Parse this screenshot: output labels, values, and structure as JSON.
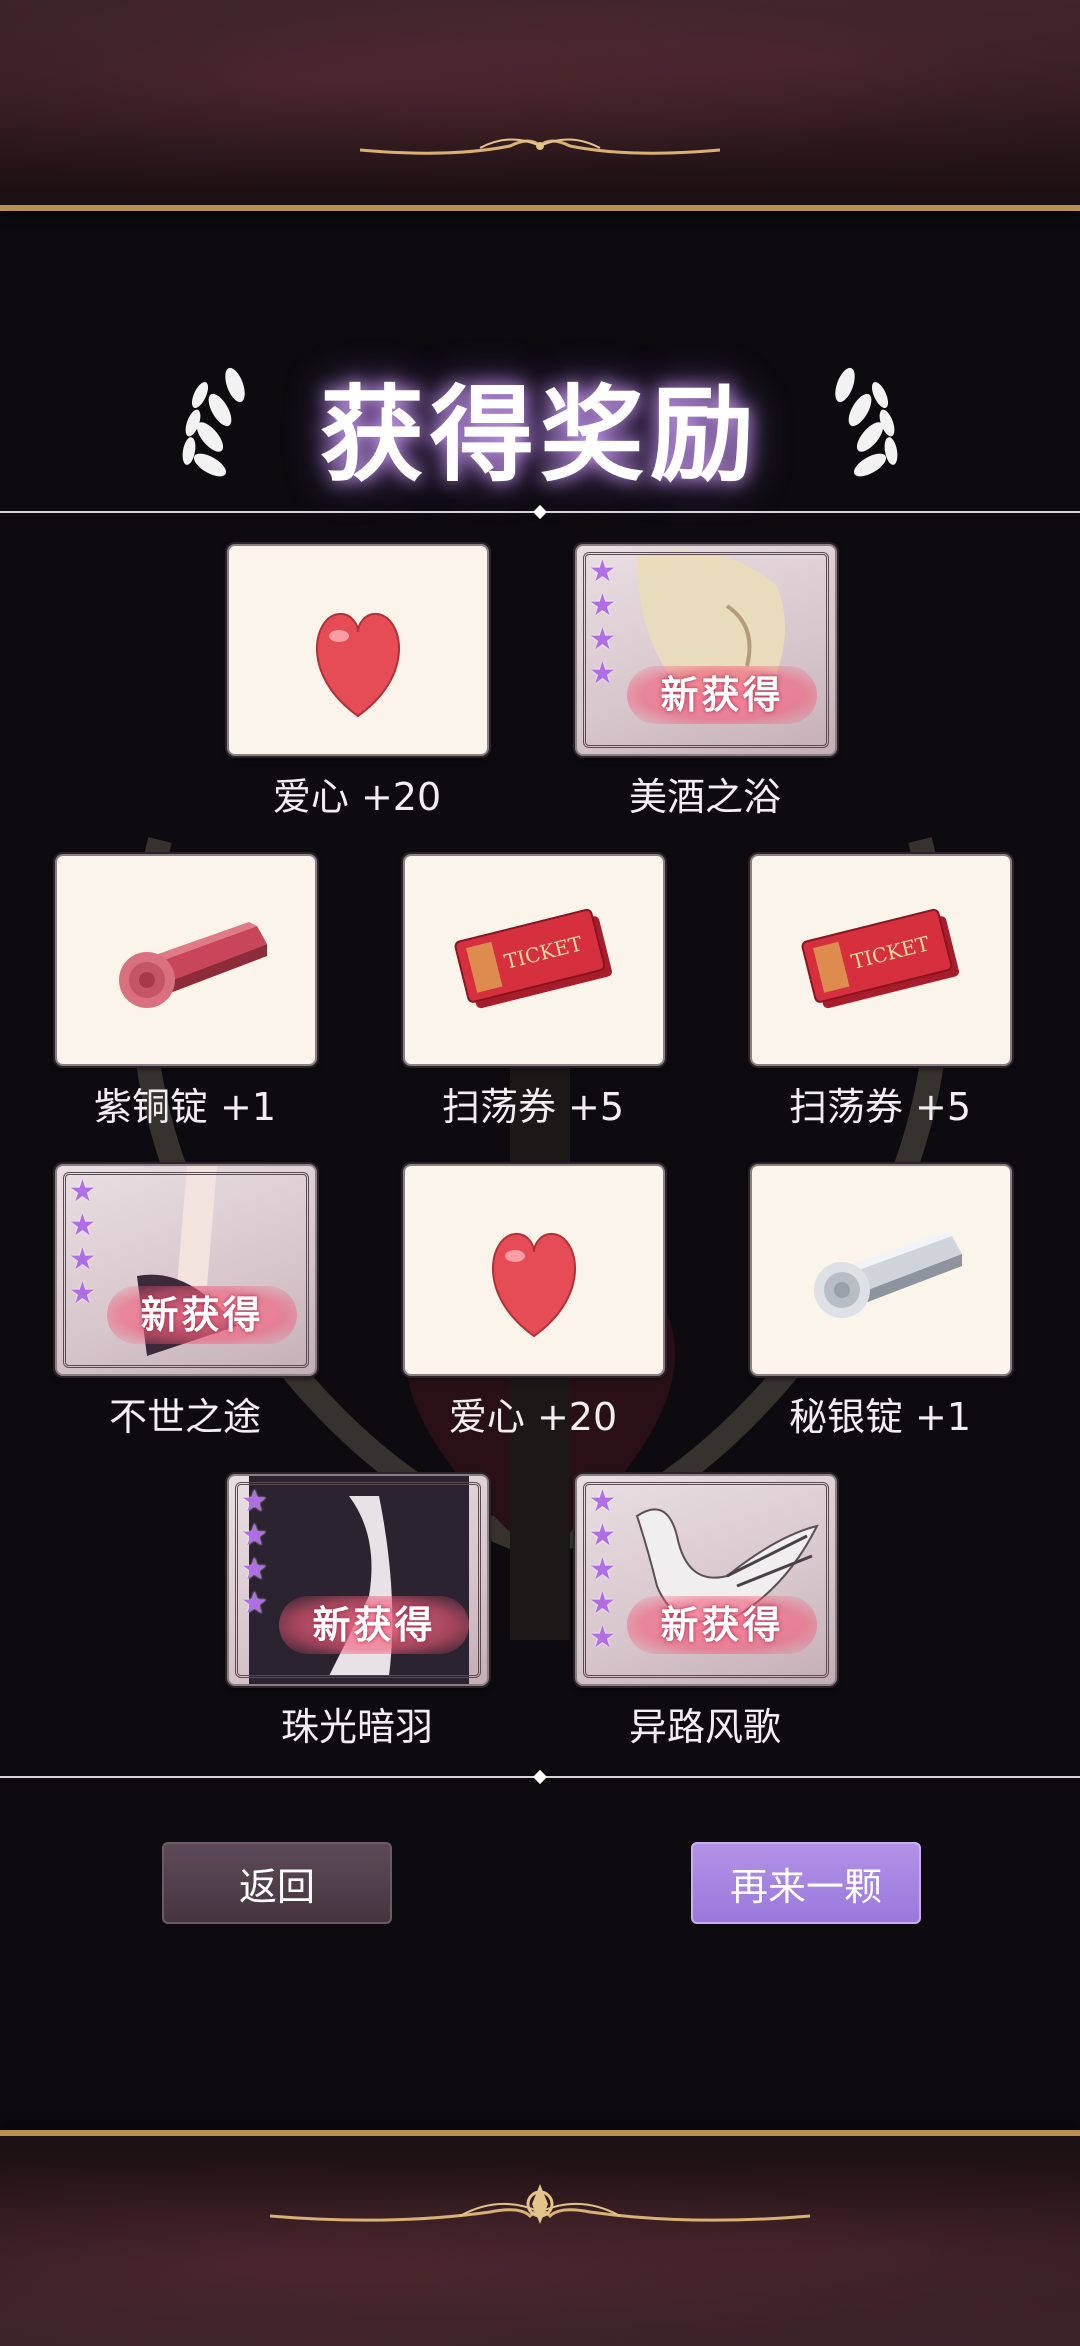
{
  "title": "获得奖励",
  "rewards": [
    {
      "label": "爱心 +20",
      "type": "heart"
    },
    {
      "label": "美酒之浴",
      "type": "character",
      "stars": 4,
      "badge": "新获得"
    },
    {
      "label": "紫铜锭 +1",
      "type": "copper-ingot"
    },
    {
      "label": "扫荡券 +5",
      "type": "ticket"
    },
    {
      "label": "扫荡券 +5",
      "type": "ticket"
    },
    {
      "label": "不世之途",
      "type": "character",
      "stars": 4,
      "badge": "新获得"
    },
    {
      "label": "爱心 +20",
      "type": "heart"
    },
    {
      "label": "秘银锭 +1",
      "type": "silver-ingot"
    },
    {
      "label": "珠光暗羽",
      "type": "character",
      "stars": 4,
      "badge": "新获得"
    },
    {
      "label": "异路风歌",
      "type": "character",
      "stars": 5,
      "badge": "新获得"
    }
  ],
  "ticket_text": "TICKET",
  "buttons": {
    "back": "返回",
    "again": "再来一颗"
  },
  "colors": {
    "accent": "#9a78dc",
    "star": "#b06ee6",
    "gold": "#b98f52"
  }
}
